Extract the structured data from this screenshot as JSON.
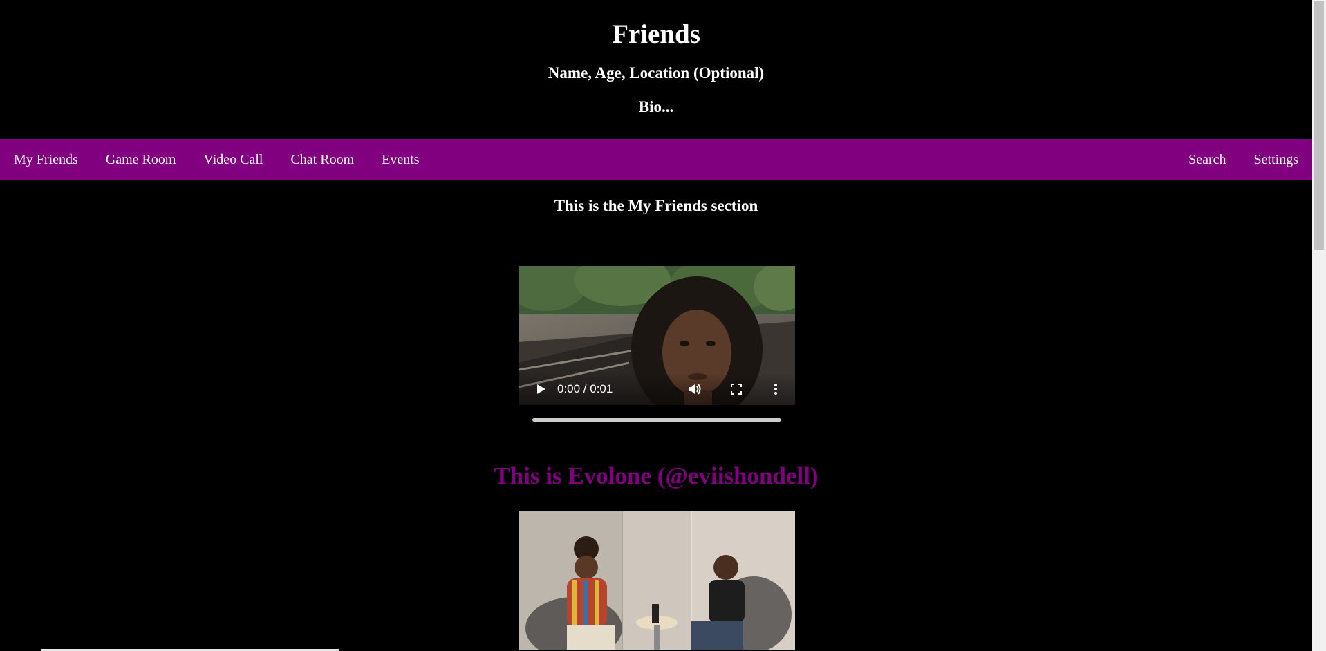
{
  "header": {
    "title": "Friends",
    "meta": "Name, Age, Location (Optional)",
    "bio": "Bio..."
  },
  "nav": {
    "left": [
      "My Friends",
      "Game Room",
      "Video Call",
      "Chat Room",
      "Events"
    ],
    "right": [
      "Search",
      "Settings"
    ],
    "background": "#800080"
  },
  "section": {
    "title": "This is the My Friends section"
  },
  "video1": {
    "time": "0:00 / 0:01",
    "controls": [
      "play-icon",
      "volume-icon",
      "fullscreen-icon",
      "more-icon"
    ]
  },
  "friend": {
    "title": "This is Evolone (@eviishondell)",
    "color": "#800080"
  }
}
